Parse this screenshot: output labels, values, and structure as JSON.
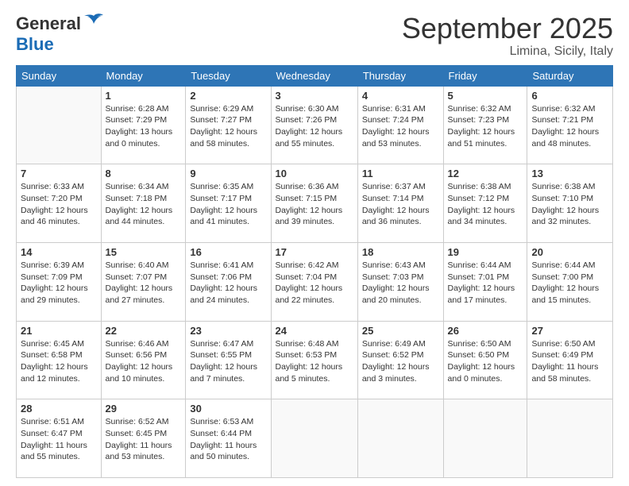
{
  "header": {
    "logo_text": "General Blue",
    "month_title": "September 2025",
    "location": "Limina, Sicily, Italy"
  },
  "days_of_week": [
    "Sunday",
    "Monday",
    "Tuesday",
    "Wednesday",
    "Thursday",
    "Friday",
    "Saturday"
  ],
  "weeks": [
    [
      {
        "day": "",
        "info": ""
      },
      {
        "day": "1",
        "info": "Sunrise: 6:28 AM\nSunset: 7:29 PM\nDaylight: 13 hours\nand 0 minutes."
      },
      {
        "day": "2",
        "info": "Sunrise: 6:29 AM\nSunset: 7:27 PM\nDaylight: 12 hours\nand 58 minutes."
      },
      {
        "day": "3",
        "info": "Sunrise: 6:30 AM\nSunset: 7:26 PM\nDaylight: 12 hours\nand 55 minutes."
      },
      {
        "day": "4",
        "info": "Sunrise: 6:31 AM\nSunset: 7:24 PM\nDaylight: 12 hours\nand 53 minutes."
      },
      {
        "day": "5",
        "info": "Sunrise: 6:32 AM\nSunset: 7:23 PM\nDaylight: 12 hours\nand 51 minutes."
      },
      {
        "day": "6",
        "info": "Sunrise: 6:32 AM\nSunset: 7:21 PM\nDaylight: 12 hours\nand 48 minutes."
      }
    ],
    [
      {
        "day": "7",
        "info": "Sunrise: 6:33 AM\nSunset: 7:20 PM\nDaylight: 12 hours\nand 46 minutes."
      },
      {
        "day": "8",
        "info": "Sunrise: 6:34 AM\nSunset: 7:18 PM\nDaylight: 12 hours\nand 44 minutes."
      },
      {
        "day": "9",
        "info": "Sunrise: 6:35 AM\nSunset: 7:17 PM\nDaylight: 12 hours\nand 41 minutes."
      },
      {
        "day": "10",
        "info": "Sunrise: 6:36 AM\nSunset: 7:15 PM\nDaylight: 12 hours\nand 39 minutes."
      },
      {
        "day": "11",
        "info": "Sunrise: 6:37 AM\nSunset: 7:14 PM\nDaylight: 12 hours\nand 36 minutes."
      },
      {
        "day": "12",
        "info": "Sunrise: 6:38 AM\nSunset: 7:12 PM\nDaylight: 12 hours\nand 34 minutes."
      },
      {
        "day": "13",
        "info": "Sunrise: 6:38 AM\nSunset: 7:10 PM\nDaylight: 12 hours\nand 32 minutes."
      }
    ],
    [
      {
        "day": "14",
        "info": "Sunrise: 6:39 AM\nSunset: 7:09 PM\nDaylight: 12 hours\nand 29 minutes."
      },
      {
        "day": "15",
        "info": "Sunrise: 6:40 AM\nSunset: 7:07 PM\nDaylight: 12 hours\nand 27 minutes."
      },
      {
        "day": "16",
        "info": "Sunrise: 6:41 AM\nSunset: 7:06 PM\nDaylight: 12 hours\nand 24 minutes."
      },
      {
        "day": "17",
        "info": "Sunrise: 6:42 AM\nSunset: 7:04 PM\nDaylight: 12 hours\nand 22 minutes."
      },
      {
        "day": "18",
        "info": "Sunrise: 6:43 AM\nSunset: 7:03 PM\nDaylight: 12 hours\nand 20 minutes."
      },
      {
        "day": "19",
        "info": "Sunrise: 6:44 AM\nSunset: 7:01 PM\nDaylight: 12 hours\nand 17 minutes."
      },
      {
        "day": "20",
        "info": "Sunrise: 6:44 AM\nSunset: 7:00 PM\nDaylight: 12 hours\nand 15 minutes."
      }
    ],
    [
      {
        "day": "21",
        "info": "Sunrise: 6:45 AM\nSunset: 6:58 PM\nDaylight: 12 hours\nand 12 minutes."
      },
      {
        "day": "22",
        "info": "Sunrise: 6:46 AM\nSunset: 6:56 PM\nDaylight: 12 hours\nand 10 minutes."
      },
      {
        "day": "23",
        "info": "Sunrise: 6:47 AM\nSunset: 6:55 PM\nDaylight: 12 hours\nand 7 minutes."
      },
      {
        "day": "24",
        "info": "Sunrise: 6:48 AM\nSunset: 6:53 PM\nDaylight: 12 hours\nand 5 minutes."
      },
      {
        "day": "25",
        "info": "Sunrise: 6:49 AM\nSunset: 6:52 PM\nDaylight: 12 hours\nand 3 minutes."
      },
      {
        "day": "26",
        "info": "Sunrise: 6:50 AM\nSunset: 6:50 PM\nDaylight: 12 hours\nand 0 minutes."
      },
      {
        "day": "27",
        "info": "Sunrise: 6:50 AM\nSunset: 6:49 PM\nDaylight: 11 hours\nand 58 minutes."
      }
    ],
    [
      {
        "day": "28",
        "info": "Sunrise: 6:51 AM\nSunset: 6:47 PM\nDaylight: 11 hours\nand 55 minutes."
      },
      {
        "day": "29",
        "info": "Sunrise: 6:52 AM\nSunset: 6:45 PM\nDaylight: 11 hours\nand 53 minutes."
      },
      {
        "day": "30",
        "info": "Sunrise: 6:53 AM\nSunset: 6:44 PM\nDaylight: 11 hours\nand 50 minutes."
      },
      {
        "day": "",
        "info": ""
      },
      {
        "day": "",
        "info": ""
      },
      {
        "day": "",
        "info": ""
      },
      {
        "day": "",
        "info": ""
      }
    ]
  ]
}
